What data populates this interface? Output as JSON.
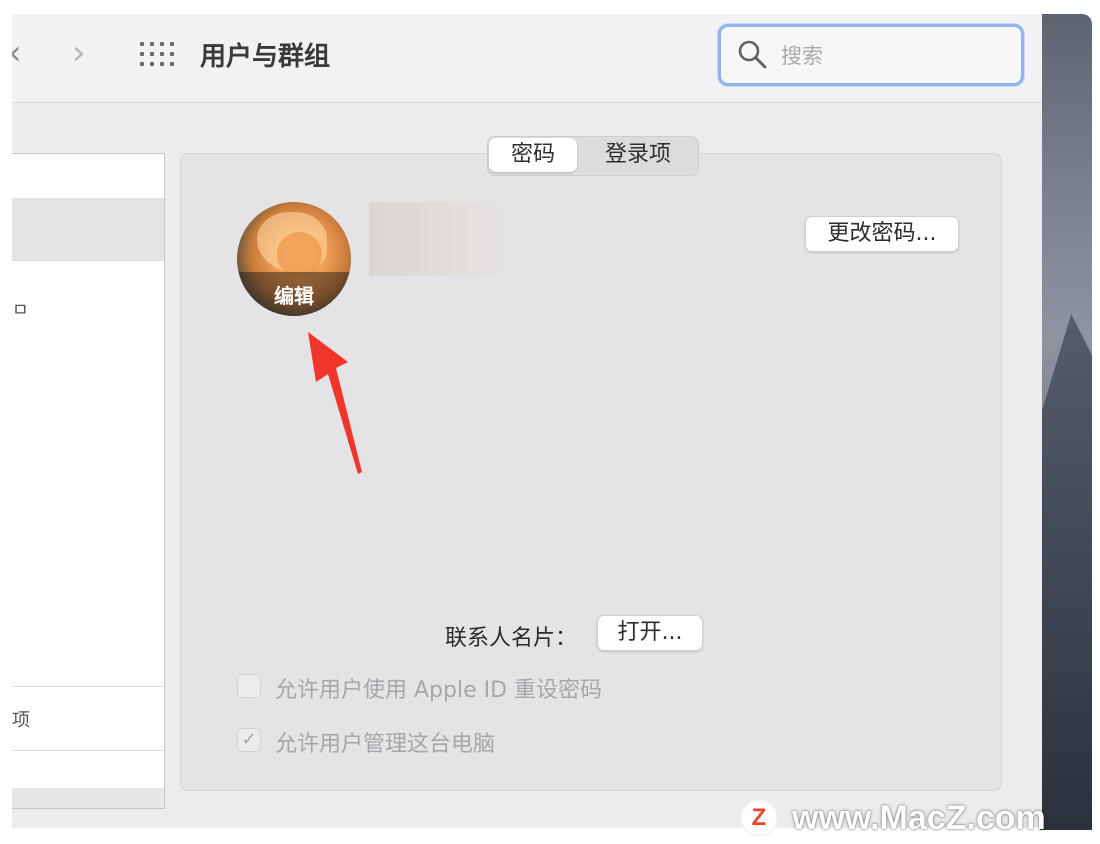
{
  "toolbar": {
    "back_glyph": "‹",
    "forward_glyph": "›",
    "title": "用户与群组",
    "search_placeholder": "搜索"
  },
  "sidebar": {
    "stub_text_1": "ㅁ",
    "stub_text_2": "项"
  },
  "tabs": [
    {
      "label": "密码",
      "active": true
    },
    {
      "label": "登录项",
      "active": false
    }
  ],
  "user": {
    "avatar_edit_label": "编辑"
  },
  "buttons": {
    "change_password": "更改密码...",
    "open": "打开..."
  },
  "contact_card": {
    "label": "联系人名片："
  },
  "options": [
    {
      "label": "允许用户使用 Apple ID 重设密码",
      "checked": false
    },
    {
      "label": "允许用户管理这台电脑",
      "checked": true
    }
  ],
  "watermark": {
    "logo_letter": "Z",
    "text": "www.MacZ.com"
  },
  "colors": {
    "annotation_arrow": "#f0352b",
    "search_focus_ring": "#8fb3ea",
    "panel_background": "#e4e3e6"
  },
  "icons": [
    "chevron-left-icon",
    "chevron-right-icon",
    "grid-icon",
    "search-icon",
    "checkmark-icon",
    "annotation-arrow"
  ]
}
